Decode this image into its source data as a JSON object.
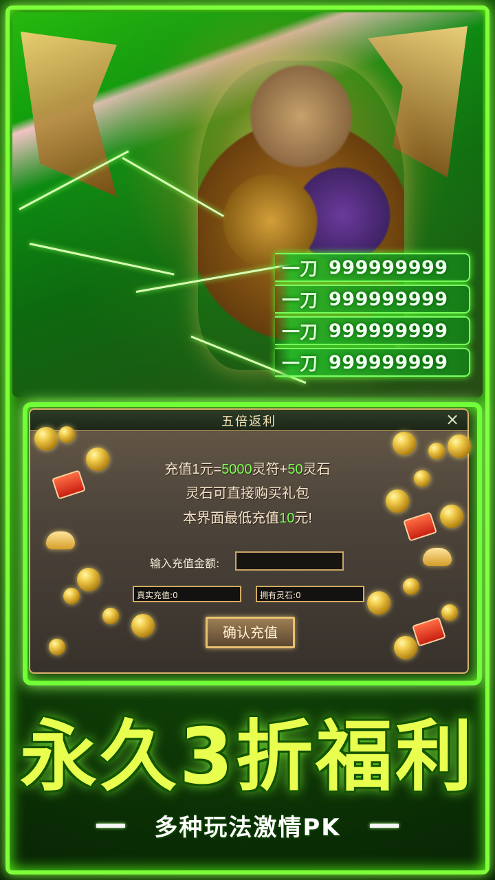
{
  "hero": {
    "rank_entries": [
      {
        "prefix": "一刀",
        "value": "999999999"
      },
      {
        "prefix": "一刀",
        "value": "999999999"
      },
      {
        "prefix": "一刀",
        "value": "999999999"
      },
      {
        "prefix": "一刀",
        "value": "999999999"
      }
    ]
  },
  "panel": {
    "title": "五倍返利",
    "close_icon": "×",
    "line1_pre": "充值1元=",
    "line1_hl1": "5000",
    "line1_mid": "灵符+",
    "line1_hl2": "50",
    "line1_post": "灵石",
    "line2": "灵石可直接购买礼包",
    "line3_pre": "本界面最低充值",
    "line3_hl": "10",
    "line3_post": "元!",
    "input_label": "输入充值金额:",
    "real_recharge": "真实充值:0",
    "owned_stones": "拥有灵石:0",
    "confirm_button": "确认充值"
  },
  "promo": {
    "headline": "永久3折福利",
    "subline": "多种玩法激情PK"
  },
  "colors": {
    "accent_green": "#7dff3a",
    "headline_yellow": "#e8ff4f"
  }
}
